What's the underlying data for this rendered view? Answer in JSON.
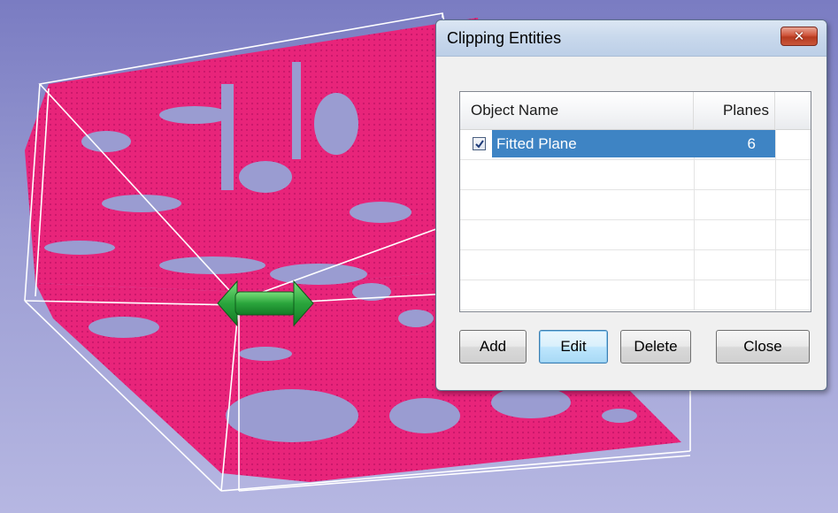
{
  "dialog": {
    "title": "Clipping Entities",
    "close_icon": "close-x-icon"
  },
  "list": {
    "columns": [
      "Object Name",
      "Planes"
    ],
    "rows": [
      {
        "checked": true,
        "name": "Fitted Plane",
        "planes": "6",
        "selected": true
      }
    ]
  },
  "buttons": {
    "add": "Add",
    "edit": "Edit",
    "delete": "Delete",
    "close": "Close"
  },
  "scene": {
    "point_cloud_color": "#e8247a",
    "background_color": "#8e90cc",
    "bounding_box_color": "#ffffff",
    "gizmo_color": "#2aa53c",
    "gizmo_icon": "double-arrow-gizmo-icon"
  }
}
